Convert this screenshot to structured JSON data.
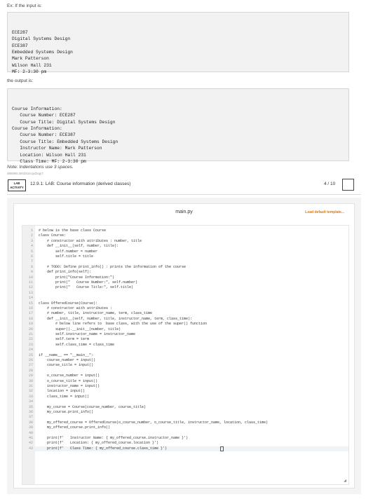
{
  "intro": {
    "input_label": "Ex: If the input is:",
    "input_lines": [
      "ECE287",
      "Digital Systems Design",
      "ECE387",
      "Embedded Systems Design",
      "Mark Patterson",
      "Wilson Hall 231",
      "MF: 2-3:30 pm"
    ],
    "output_label": "the output is:",
    "output_lines": [
      "Course Information:",
      "   Course Number: ECE287",
      "   Course Title: Digital Systems Design",
      "Course Information:",
      "   Course Number: ECE387",
      "   Course Title: Embedded Systems Design",
      "   Instructor Name: Mark Patterson",
      "   Location: Wilson Hall 231",
      "   Class Time: MF: 2-3:30 pm"
    ],
    "note": "Note: Indentations use 3 spaces.",
    "activity_id": "465060.3043410.qx3zqy7"
  },
  "lab": {
    "badge_line1": "LAB",
    "badge_line2": "ACTIVITY",
    "title": "12.9.1: LAB: Course information (derived classes)",
    "score": "4 / 10"
  },
  "editor": {
    "filename": "main.py",
    "load_template": "Load default template...",
    "lines": [
      "# below is the base class Course",
      "class Course:",
      "    # constructor with attributes : number, title",
      "    def __init__(self, number, title):",
      "        self.number = number",
      "        self.title = title",
      "",
      "    # TODO: Define print_info() : prints the information of the course",
      "    def print_info(self):",
      "        print(\"Course Information:\")",
      "        print(\"   Course Number:\", self.number)",
      "        print(\"   Course Title:\", self.title)",
      "",
      "",
      "class OfferedCourse(Course):",
      "    # constructor with attributes :",
      "    # number, title, instructor_name, term, class_time",
      "    def __init__(self, number, title, instructor_name, term, class_time):",
      "        # below line refers to  base class, with the use of the super() function",
      "        super().__init__(number, title)",
      "        self.instructor_name = instructor_name",
      "        self.term = term",
      "        self.class_time = class_time",
      "",
      "if __name__ == \"__main__\":",
      "    course_number = input()",
      "    course_title = input()",
      "",
      "    o_course_number = input()",
      "    o_course_title = input()",
      "    instructor_name = input()",
      "    location = input()",
      "    class_time = input()",
      "",
      "    my_course = Course(course_number, course_title)",
      "    my_course.print_info()",
      "",
      "    my_offered_course = OfferedCourse(o_course_number, o_course_title, instructor_name, location, class_time)",
      "    my_offered_course.print_info()",
      "",
      "    print(f'   Instructor Name: { my_offered_course.instructor_name }')",
      "    print(f'   Location: { my_offered_course.location }')",
      "    print(f'   Class Time: { my_offered_course.class_time }')"
    ]
  }
}
